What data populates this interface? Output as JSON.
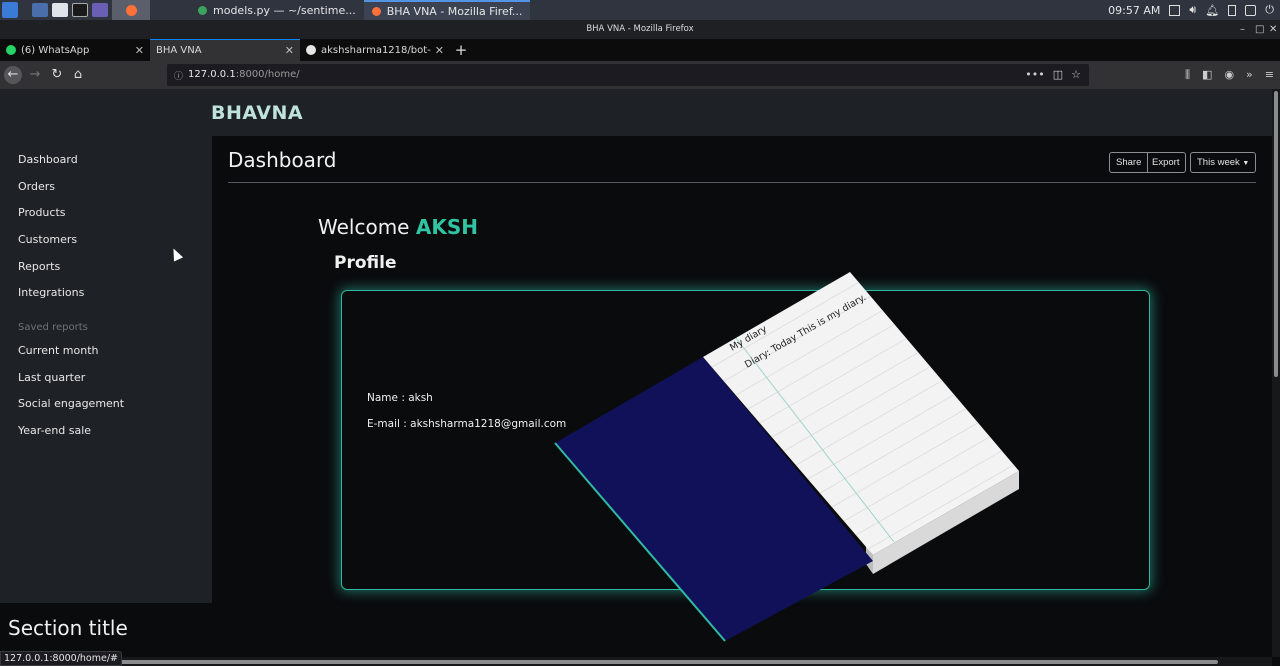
{
  "taskbar": {
    "tasks": [
      {
        "label": "models.py — ~/sentime..."
      },
      {
        "label": "BHA VNA - Mozilla Firef..."
      }
    ],
    "clock": "09:57 AM"
  },
  "window": {
    "title": "BHA VNA - Mozilla Firefox"
  },
  "tabs": [
    {
      "label": "(6) WhatsApp"
    },
    {
      "label": "BHA VNA"
    },
    {
      "label": "akshsharma1218/bot-ha"
    }
  ],
  "address": {
    "host": "127.0.0.1",
    "path": ":8000/home/"
  },
  "site": {
    "brand": "BHAVNA"
  },
  "sidebar": {
    "items": [
      "Dashboard",
      "Orders",
      "Products",
      "Customers",
      "Reports",
      "Integrations"
    ],
    "saved_heading": "Saved reports",
    "saved": [
      "Current month",
      "Last quarter",
      "Social engagement",
      "Year-end sale"
    ]
  },
  "dashboard": {
    "title": "Dashboard",
    "buttons": {
      "share": "Share",
      "export": "Export",
      "period": "This week"
    }
  },
  "welcome": {
    "prefix": "Welcome",
    "name": "AKSH"
  },
  "profile": {
    "heading": "Profile",
    "name_line": "Name : aksh",
    "email_line": "E-mail : akshsharma1218@gmail.com"
  },
  "diary": {
    "title": "My diary",
    "entry": "Diary: Today This is my diary.",
    "cover_color": "#11115a"
  },
  "section_title": "Section title",
  "status_url": "127.0.0.1:8000/home/#",
  "colors": {
    "accent": "#31c4a3",
    "sidebar_bg": "#1e2227",
    "page_bg": "#0a0b0d"
  }
}
